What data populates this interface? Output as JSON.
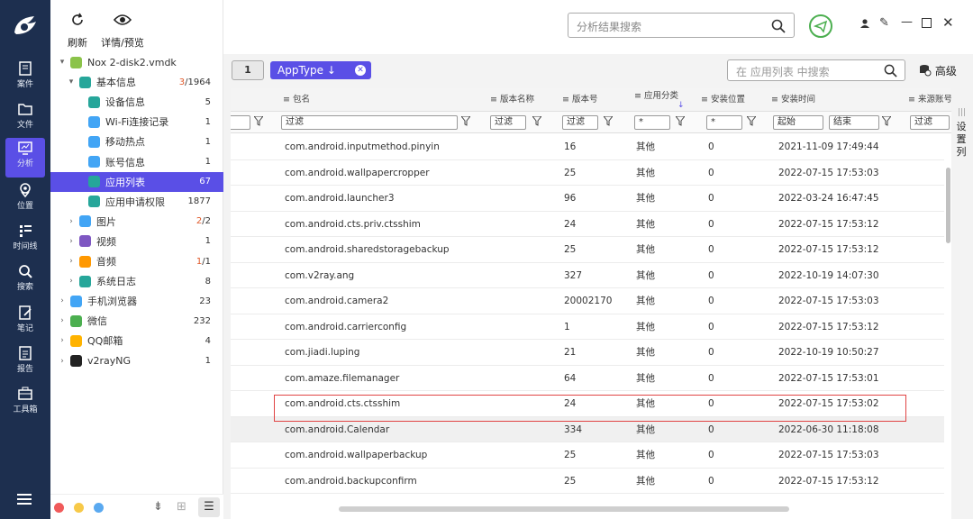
{
  "nav": {
    "items": [
      {
        "label": "案件",
        "icon": "case-icon"
      },
      {
        "label": "文件",
        "icon": "folder-icon"
      },
      {
        "label": "分析",
        "icon": "analysis-icon",
        "active": true
      },
      {
        "label": "位置",
        "icon": "location-icon"
      },
      {
        "label": "时间线",
        "icon": "timeline-icon"
      },
      {
        "label": "搜索",
        "icon": "search-icon"
      },
      {
        "label": "笔记",
        "icon": "note-icon"
      },
      {
        "label": "报告",
        "icon": "report-icon"
      },
      {
        "label": "工具箱",
        "icon": "toolbox-icon"
      }
    ]
  },
  "toolbar": {
    "refresh_label": "刷新",
    "detail_label": "详情/预览"
  },
  "tree": {
    "items": [
      {
        "label": "Nox 2-disk2.vmdk",
        "count": "",
        "red": "",
        "icon": "android-icon",
        "color": "#8bc34a",
        "arrow": "▾"
      },
      {
        "label": "基本信息",
        "count": "/1964",
        "red": "3",
        "icon": "info-icon",
        "color": "#26a69a",
        "arrow": "▾"
      },
      {
        "label": "设备信息",
        "count": "5",
        "red": "",
        "icon": "device-icon",
        "color": "#26a69a",
        "arrow": ""
      },
      {
        "label": "Wi-Fi连接记录",
        "count": "1",
        "red": "",
        "icon": "wifi-icon",
        "color": "#42a5f5",
        "arrow": ""
      },
      {
        "label": "移动热点",
        "count": "1",
        "red": "",
        "icon": "hotspot-icon",
        "color": "#42a5f5",
        "arrow": ""
      },
      {
        "label": "账号信息",
        "count": "1",
        "red": "",
        "icon": "account-icon",
        "color": "#42a5f5",
        "arrow": ""
      },
      {
        "label": "应用列表",
        "count": "67",
        "red": "",
        "icon": "app-list-icon",
        "color": "#26a69a",
        "arrow": "",
        "selected": true
      },
      {
        "label": "应用申请权限",
        "count": "1877",
        "red": "",
        "icon": "permission-icon",
        "color": "#26a69a",
        "arrow": ""
      },
      {
        "label": "图片",
        "count": "/2",
        "red": "2",
        "icon": "image-icon",
        "color": "#42a5f5",
        "arrow": "›"
      },
      {
        "label": "视频",
        "count": "1",
        "red": "",
        "icon": "video-icon",
        "color": "#7e57c2",
        "arrow": "›"
      },
      {
        "label": "音频",
        "count": "/1",
        "red": "1",
        "icon": "audio-icon",
        "color": "#ff9800",
        "arrow": "›"
      },
      {
        "label": "系统日志",
        "count": "8",
        "red": "",
        "icon": "log-icon",
        "color": "#26a69a",
        "arrow": "›"
      },
      {
        "label": "手机浏览器",
        "count": "23",
        "red": "",
        "icon": "browser-icon",
        "color": "#42a5f5",
        "arrow": "›"
      },
      {
        "label": "微信",
        "count": "232",
        "red": "",
        "icon": "wechat-icon",
        "color": "#4caf50",
        "arrow": "›"
      },
      {
        "label": "QQ邮箱",
        "count": "4",
        "red": "",
        "icon": "qqmail-icon",
        "color": "#ffb300",
        "arrow": "›"
      },
      {
        "label": "v2rayNG",
        "count": "1",
        "red": "",
        "icon": "v2ray-icon",
        "color": "#222222",
        "arrow": "›"
      }
    ]
  },
  "search": {
    "placeholder": "分析结果搜索"
  },
  "list": {
    "badge": "1",
    "chip_label": "AppType ↓",
    "search_placeholder": "在 应用列表 中搜索",
    "advanced_label": "高级",
    "columns": [
      "包名",
      "版本名称",
      "版本号",
      "应用分类",
      "安装位置",
      "安装时间",
      "来源账号"
    ],
    "filters": {
      "pkg": "过滤",
      "vname": "过滤",
      "vcode": "过滤",
      "category": "*",
      "location": "*",
      "start": "起始",
      "end": "结束",
      "source": "过滤"
    },
    "side_panel_label": "设置列",
    "rows": [
      {
        "pkg": "com.android.inputmethod.pinyin",
        "vcode": "16",
        "cat": "其他",
        "loc": "0",
        "time": "2021-11-09 17:49:44"
      },
      {
        "pkg": "com.android.wallpapercropper",
        "vcode": "25",
        "cat": "其他",
        "loc": "0",
        "time": "2022-07-15 17:53:03"
      },
      {
        "pkg": "com.android.launcher3",
        "vcode": "96",
        "cat": "其他",
        "loc": "0",
        "time": "2022-03-24 16:47:45"
      },
      {
        "pkg": "com.android.cts.priv.ctsshim",
        "vcode": "24",
        "cat": "其他",
        "loc": "0",
        "time": "2022-07-15 17:53:12"
      },
      {
        "pkg": "com.android.sharedstoragebackup",
        "vcode": "25",
        "cat": "其他",
        "loc": "0",
        "time": "2022-07-15 17:53:12"
      },
      {
        "pkg": "com.v2ray.ang",
        "vcode": "327",
        "cat": "其他",
        "loc": "0",
        "time": "2022-10-19 14:07:30"
      },
      {
        "pkg": "com.android.camera2",
        "vcode": "20002170",
        "cat": "其他",
        "loc": "0",
        "time": "2022-07-15 17:53:03"
      },
      {
        "pkg": "com.android.carrierconfig",
        "vcode": "1",
        "cat": "其他",
        "loc": "0",
        "time": "2022-07-15 17:53:12"
      },
      {
        "pkg": "com.jiadi.luping",
        "vcode": "21",
        "cat": "其他",
        "loc": "0",
        "time": "2022-10-19 10:50:27",
        "highlight": true
      },
      {
        "pkg": "com.amaze.filemanager",
        "vcode": "64",
        "cat": "其他",
        "loc": "0",
        "time": "2022-07-15 17:53:01"
      },
      {
        "pkg": "com.android.cts.ctsshim",
        "vcode": "24",
        "cat": "其他",
        "loc": "0",
        "time": "2022-07-15 17:53:02"
      },
      {
        "pkg": "com.android.Calendar",
        "vcode": "334",
        "cat": "其他",
        "loc": "0",
        "time": "2022-06-30 11:18:08",
        "shaded": true
      },
      {
        "pkg": "com.android.wallpaperbackup",
        "vcode": "25",
        "cat": "其他",
        "loc": "0",
        "time": "2022-07-15 17:53:03"
      },
      {
        "pkg": "com.android.backupconfirm",
        "vcode": "25",
        "cat": "其他",
        "loc": "0",
        "time": "2022-07-15 17:53:12"
      }
    ]
  }
}
